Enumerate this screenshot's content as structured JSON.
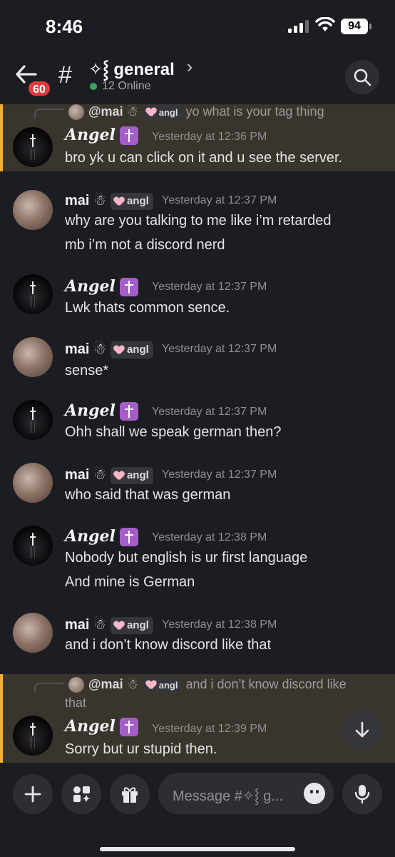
{
  "status_bar": {
    "time": "8:46",
    "battery": "94"
  },
  "header": {
    "unread_badge": "60",
    "channel_prefix": "#",
    "channel_name": "✧⸾  general",
    "chevron": "›",
    "online_count": "12 Online"
  },
  "messages": [
    {
      "reply": {
        "author": "@mai ☃",
        "tag": "angl",
        "text": "yo what is your tag thing"
      },
      "author": "𝑨𝒏𝒈𝒆𝒍",
      "timestamp": "Yesterday at 12:36 PM",
      "lines": [
        "bro yk u can click on it and u see the server."
      ]
    },
    {
      "author": "mai ☃",
      "tag": "angl",
      "timestamp": "Yesterday at 12:37 PM",
      "lines": [
        "why are you talking to me like i’m retarded",
        "mb i’m not a discord nerd"
      ]
    },
    {
      "author": "𝑨𝒏𝒈𝒆𝒍",
      "timestamp": "Yesterday at 12:37 PM",
      "lines": [
        "Lwk thats common sence."
      ]
    },
    {
      "author": "mai ☃",
      "tag": "angl",
      "timestamp": "Yesterday at 12:37 PM",
      "lines": [
        "sense*"
      ]
    },
    {
      "author": "𝑨𝒏𝒈𝒆𝒍",
      "timestamp": "Yesterday at 12:37 PM",
      "lines": [
        "Ohh shall we speak german then?"
      ]
    },
    {
      "author": "mai ☃",
      "tag": "angl",
      "timestamp": "Yesterday at 12:37 PM",
      "lines": [
        "who said that was german"
      ]
    },
    {
      "author": "𝑨𝒏𝒈𝒆𝒍",
      "timestamp": "Yesterday at 12:38 PM",
      "lines": [
        "Nobody but english is ur first language",
        "And mine is German"
      ]
    },
    {
      "author": "mai ☃",
      "tag": "angl",
      "timestamp": "Yesterday at 12:38 PM",
      "lines": [
        "and i don’t know discord like that"
      ]
    },
    {
      "reply": {
        "author": "@mai ☃",
        "tag": "angl",
        "text": "and i don’t know discord like",
        "text_cont": "that"
      },
      "author": "𝑨𝒏𝒈𝒆𝒍",
      "timestamp": "Yesterday at 12:39 PM",
      "lines": [
        "Sorry but ur stupid then."
      ]
    }
  ],
  "composer": {
    "placeholder": "Message #✧⸾  g..."
  },
  "colors": {
    "highlight_bar": "#f0b232",
    "highlight_bg": "#3a352c",
    "badge": "#e23a3d",
    "online": "#3ba55c",
    "role_tag": "#a55ec9"
  }
}
